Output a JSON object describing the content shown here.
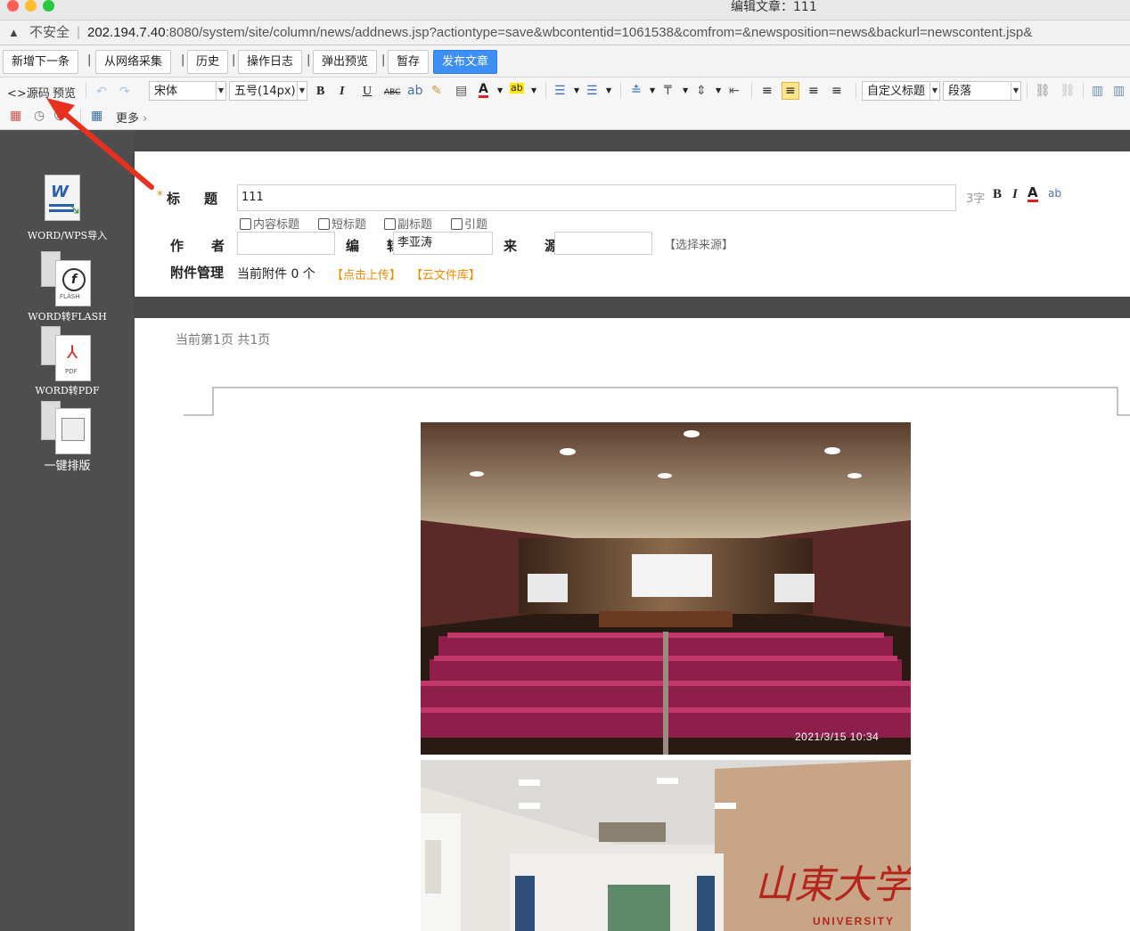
{
  "window": {
    "title": "编辑文章：111"
  },
  "browser": {
    "insecure_label": "不安全",
    "url_host": "202.194.7.40",
    "url_rest": ":8080/system/site/column/news/addnews.jsp?actiontype=save&wbcontentid=1061538&comfrom=&newsposition=news&backurl=newscontent.jsp&"
  },
  "actionbar": {
    "add_next": "新增下一条",
    "collect": "从网络采集",
    "history": "历史",
    "oplog": "操作日志",
    "popup_preview": "弹出预览",
    "draft": "暂存",
    "publish": "发布文章"
  },
  "toolbar": {
    "source": "源码",
    "preview": "预览",
    "font_family": "宋体",
    "font_size": "五号(14px)",
    "bold": "B",
    "italic": "I",
    "underline": "U",
    "strike": "ABC",
    "custom_title": "自定义标题",
    "paragraph": "段落",
    "more": "更多"
  },
  "sidebar": {
    "items": [
      {
        "label": "WORD/WPS导入"
      },
      {
        "label": "WORD转FLASH"
      },
      {
        "label": "WORD转PDF"
      },
      {
        "label": "一键排版"
      }
    ]
  },
  "form": {
    "title_label": "标　题",
    "title_value": "111",
    "title_count": "3字",
    "checkboxes": [
      "内容标题",
      "短标题",
      "副标题",
      "引题"
    ],
    "author_label": "作　者",
    "author_value": "",
    "editor_label": "编　辑",
    "editor_value": "李亚涛",
    "source_label": "来　源",
    "source_value": "",
    "select_source": "【选择来源】",
    "attach_label": "附件管理",
    "attach_current": "当前附件 0 个",
    "attach_upload": "【点击上传】",
    "attach_cloud": "【云文件库】"
  },
  "editor": {
    "page_info": "当前第1页  共1页",
    "photo_timestamp": "2021/3/15 10:34"
  },
  "colors": {
    "publish_blue": "#3d8ef5",
    "link_orange": "#f08a00",
    "sidebar_gray": "#4e4e4e",
    "annotation_red": "#e8301f"
  }
}
